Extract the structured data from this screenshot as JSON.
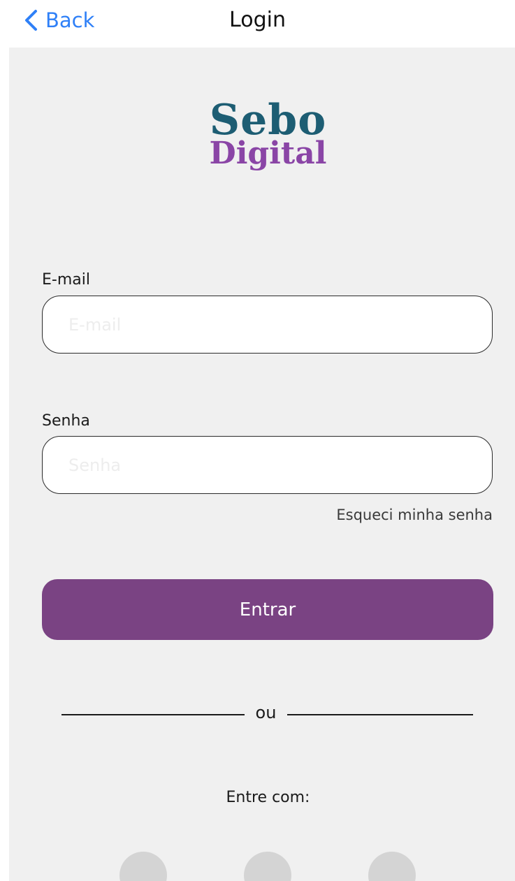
{
  "nav": {
    "back_label": "Back",
    "title": "Login"
  },
  "logo": {
    "line1": "Sebo",
    "line2": "Digital"
  },
  "form": {
    "email": {
      "label": "E-mail",
      "placeholder": "E-mail",
      "value": ""
    },
    "password": {
      "label": "Senha",
      "placeholder": "Senha",
      "value": ""
    },
    "forgot_label": "Esqueci minha senha",
    "submit_label": "Entrar"
  },
  "divider": {
    "text": "ou"
  },
  "social": {
    "title": "Entre com:",
    "providers": [
      "social-login-1",
      "social-login-2",
      "social-login-3"
    ]
  },
  "colors": {
    "accent": "#2f80f7",
    "brand_primary": "#7a4383",
    "logo_teal": "#1d5d73",
    "logo_purple": "#8a45a6",
    "panel_bg": "#f0f0f0"
  }
}
